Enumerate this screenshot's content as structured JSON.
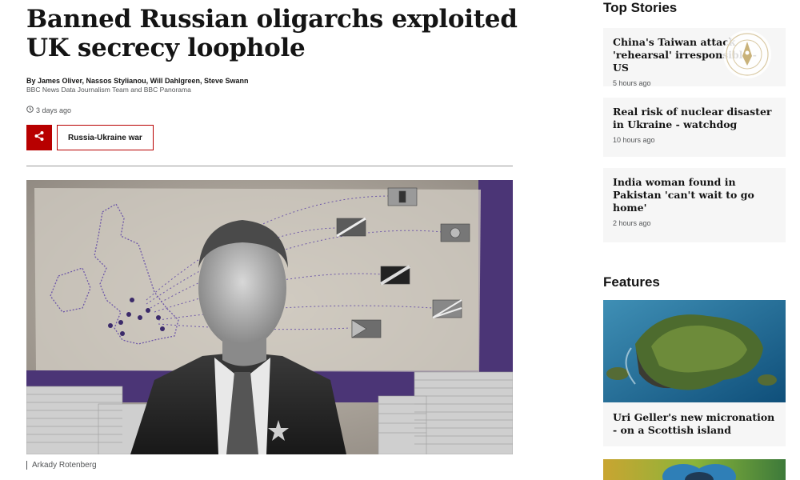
{
  "article": {
    "headline": "Banned Russian oligarchs exploited UK secrecy loophole",
    "byline": "By James Oliver, Nassos Stylianou, Will Dahlgreen, Steve Swann",
    "team": "BBC News Data Journalism Team and BBC Panorama",
    "timestamp": "3 days ago",
    "tag": "Russia-Ukraine war",
    "image_caption": "Arkady Rotenberg"
  },
  "top_stories": {
    "title": "Top Stories",
    "items": [
      {
        "headline": "China's Taiwan attack 'rehearsal' irresponsible - US",
        "time": "5 hours ago"
      },
      {
        "headline": "Real risk of nuclear disaster in Ukraine - watchdog",
        "time": "10 hours ago"
      },
      {
        "headline": "India woman found in Pakistan 'can't wait to go home'",
        "time": "2 hours ago"
      }
    ]
  },
  "features": {
    "title": "Features",
    "items": [
      {
        "headline": "Uri Geller's new micronation - on a Scottish island"
      }
    ]
  },
  "colors": {
    "accent": "#b80000",
    "text": "#141414",
    "muted": "#545658",
    "card_bg": "#f6f6f6"
  },
  "icons": [
    "share-icon",
    "clock-icon",
    "watermark-seal"
  ]
}
